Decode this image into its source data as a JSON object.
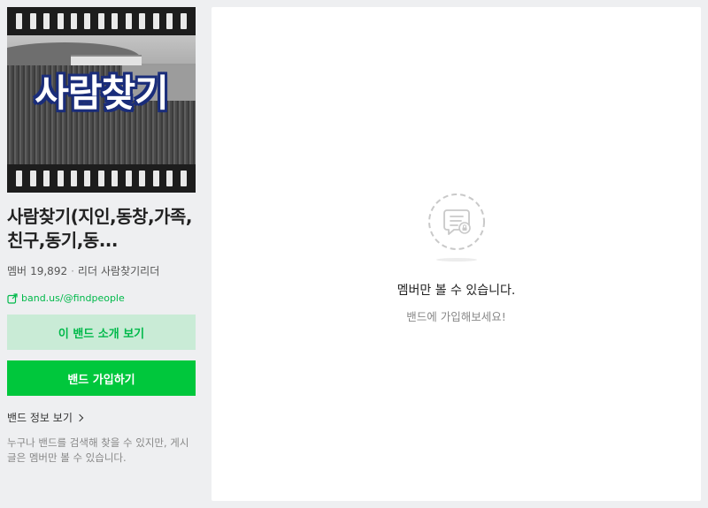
{
  "sidebar": {
    "cover": {
      "title_text": "사람찾기"
    },
    "band_name": "사람찾기(지인,동창,가족,친구,동기,동...",
    "member_label": "멤버",
    "member_count": "19,892",
    "separator": "·",
    "leader_label": "리더",
    "leader_name": "사람찾기리더",
    "band_url": "band.us/@findpeople",
    "intro_button": "이 밴드 소개 보기",
    "join_button": "밴드 가입하기",
    "info_link": "밴드 정보 보기",
    "description": "누구나 밴드를 검색해 찾을 수 있지만, 게시글은 멤버만 볼 수 있습니다."
  },
  "main": {
    "empty_title": "멤버만 볼 수 있습니다.",
    "empty_subtitle": "밴드에 가입해보세요!"
  },
  "colors": {
    "brand_green": "#00c73c",
    "link_green": "#00b94a",
    "intro_bg": "#c9ebd6",
    "page_bg": "#eeeff1"
  },
  "icons": {
    "link": "external-link-icon",
    "chevron": "chevron-right-icon",
    "empty": "locked-post-icon"
  }
}
